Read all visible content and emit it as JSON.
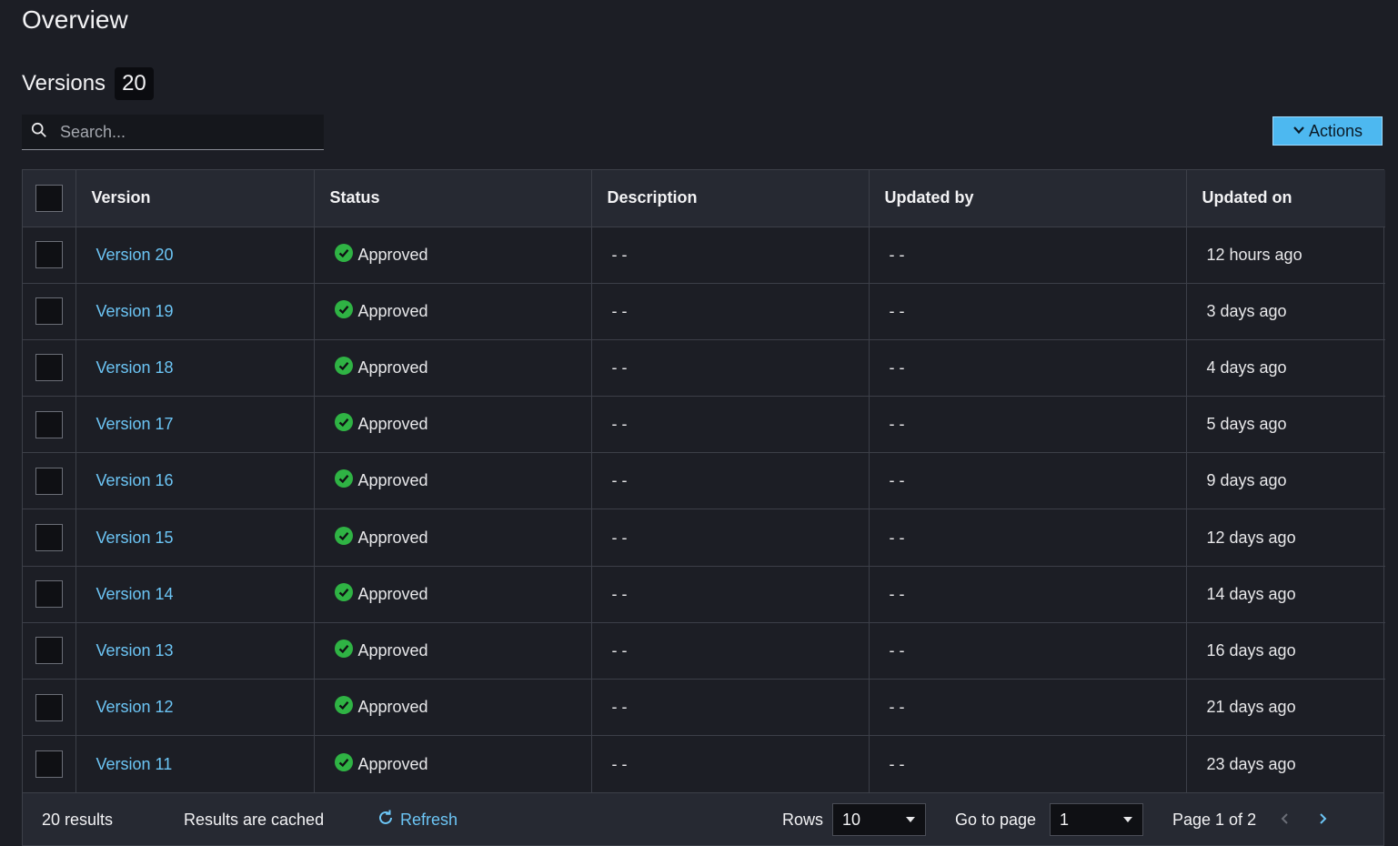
{
  "header": {
    "title": "Overview"
  },
  "versions": {
    "label": "Versions",
    "count": "20"
  },
  "search": {
    "placeholder": "Search..."
  },
  "toolbar": {
    "actions_label": "Actions"
  },
  "table": {
    "columns": [
      "Version",
      "Status",
      "Description",
      "Updated by",
      "Updated on"
    ],
    "rows": [
      {
        "version": "Version 20",
        "status": "Approved",
        "description": "- -",
        "updated_by": "- -",
        "updated_on": "12 hours ago"
      },
      {
        "version": "Version 19",
        "status": "Approved",
        "description": "- -",
        "updated_by": "- -",
        "updated_on": "3 days ago"
      },
      {
        "version": "Version 18",
        "status": "Approved",
        "description": "- -",
        "updated_by": "- -",
        "updated_on": "4 days ago"
      },
      {
        "version": "Version 17",
        "status": "Approved",
        "description": "- -",
        "updated_by": "- -",
        "updated_on": "5 days ago"
      },
      {
        "version": "Version 16",
        "status": "Approved",
        "description": "- -",
        "updated_by": "- -",
        "updated_on": "9 days ago"
      },
      {
        "version": "Version 15",
        "status": "Approved",
        "description": "- -",
        "updated_by": "- -",
        "updated_on": "12 days ago"
      },
      {
        "version": "Version 14",
        "status": "Approved",
        "description": "- -",
        "updated_by": "- -",
        "updated_on": "14 days ago"
      },
      {
        "version": "Version 13",
        "status": "Approved",
        "description": "- -",
        "updated_by": "- -",
        "updated_on": "16 days ago"
      },
      {
        "version": "Version 12",
        "status": "Approved",
        "description": "- -",
        "updated_by": "- -",
        "updated_on": "21 days ago"
      },
      {
        "version": "Version 11",
        "status": "Approved",
        "description": "- -",
        "updated_by": "- -",
        "updated_on": "23 days ago"
      }
    ]
  },
  "footer": {
    "results": "20 results",
    "cached": "Results are cached",
    "refresh_label": "Refresh",
    "rows_label": "Rows",
    "rows_value": "10",
    "goto_label": "Go to page",
    "goto_value": "1",
    "page_info": "Page 1 of 2"
  },
  "icons": {
    "search": "search-icon",
    "actions": "chevron-down-icon",
    "status": "check-circle-icon",
    "refresh": "refresh-icon",
    "prev": "chevron-left-icon",
    "next": "chevron-right-icon"
  },
  "colors": {
    "background": "#1c1e25",
    "link": "#6cc5f5",
    "primary_button": "#4db8f0",
    "success": "#2fb344"
  }
}
